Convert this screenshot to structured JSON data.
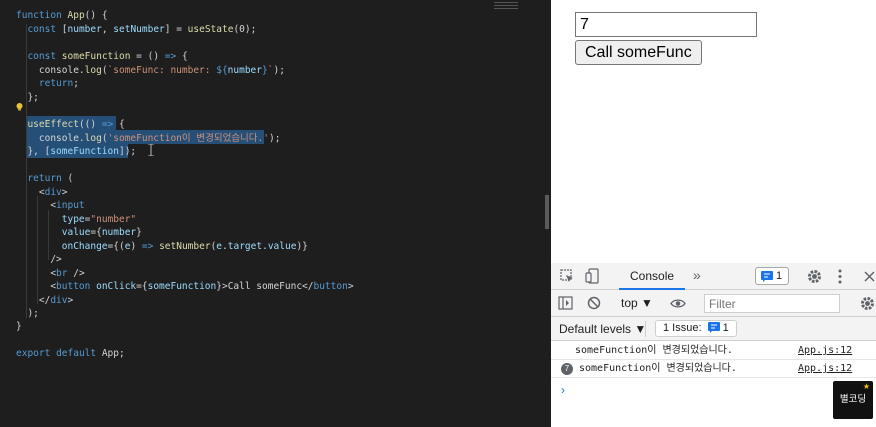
{
  "editor": {
    "lines": [
      [
        [
          "function",
          "k"
        ],
        [
          " ",
          "p"
        ],
        [
          "App",
          "f"
        ],
        [
          "() {",
          "p"
        ]
      ],
      [
        [
          "  ",
          "p"
        ],
        [
          "const",
          "k"
        ],
        [
          " [",
          "p"
        ],
        [
          "number",
          "v"
        ],
        [
          ", ",
          "p"
        ],
        [
          "setNumber",
          "v"
        ],
        [
          "] = ",
          "p"
        ],
        [
          "useState",
          "f"
        ],
        [
          "(0);",
          "p"
        ]
      ],
      [
        [
          "",
          "p"
        ]
      ],
      [
        [
          "  ",
          "p"
        ],
        [
          "const",
          "k"
        ],
        [
          " ",
          "p"
        ],
        [
          "someFunction",
          "f"
        ],
        [
          " = () ",
          "p"
        ],
        [
          "=>",
          "k"
        ],
        [
          " {",
          "p"
        ]
      ],
      [
        [
          "    console.",
          "p"
        ],
        [
          "log",
          "f"
        ],
        [
          "(",
          "p"
        ],
        [
          "`someFunc: number: ",
          "s"
        ],
        [
          "${",
          "k"
        ],
        [
          "number",
          "v"
        ],
        [
          "}",
          "k"
        ],
        [
          "`",
          "s"
        ],
        [
          ");",
          "p"
        ]
      ],
      [
        [
          "    ",
          "p"
        ],
        [
          "return",
          "k"
        ],
        [
          ";",
          "p"
        ]
      ],
      [
        [
          "  };",
          "p"
        ]
      ],
      [
        [
          "",
          "p"
        ]
      ],
      [
        [
          "  ",
          "p"
        ],
        [
          "useEffect",
          "f"
        ],
        [
          "(() ",
          "p"
        ],
        [
          "=>",
          "k"
        ],
        [
          " {",
          "p"
        ]
      ],
      [
        [
          "    console.",
          "p"
        ],
        [
          "log",
          "f"
        ],
        [
          "(",
          "p"
        ],
        [
          "'someFunction이 변경되었습니다.'",
          "s"
        ],
        [
          ");",
          "p"
        ]
      ],
      [
        [
          "  }, [",
          "p"
        ],
        [
          "someFunction",
          "v"
        ],
        [
          "]);",
          "p"
        ]
      ],
      [
        [
          "",
          "p"
        ]
      ],
      [
        [
          "  ",
          "p"
        ],
        [
          "return",
          "k"
        ],
        [
          " (",
          "p"
        ]
      ],
      [
        [
          "    <",
          "p"
        ],
        [
          "div",
          "t"
        ],
        [
          ">",
          "p"
        ]
      ],
      [
        [
          "      <",
          "p"
        ],
        [
          "input",
          "t"
        ]
      ],
      [
        [
          "        ",
          "p"
        ],
        [
          "type",
          "a"
        ],
        [
          "=",
          "p"
        ],
        [
          "\"number\"",
          "s"
        ]
      ],
      [
        [
          "        ",
          "p"
        ],
        [
          "value",
          "a"
        ],
        [
          "={",
          "p"
        ],
        [
          "number",
          "v"
        ],
        [
          "}",
          "p"
        ]
      ],
      [
        [
          "        ",
          "p"
        ],
        [
          "onChange",
          "a"
        ],
        [
          "={(",
          "p"
        ],
        [
          "e",
          "v"
        ],
        [
          ") ",
          "p"
        ],
        [
          "=>",
          "k"
        ],
        [
          " ",
          "p"
        ],
        [
          "setNumber",
          "f"
        ],
        [
          "(",
          "p"
        ],
        [
          "e",
          "v"
        ],
        [
          ".",
          "p"
        ],
        [
          "target",
          "v"
        ],
        [
          ".",
          "p"
        ],
        [
          "value",
          "v"
        ],
        [
          ")}",
          "p"
        ]
      ],
      [
        [
          "      />",
          "p"
        ]
      ],
      [
        [
          "      <",
          "p"
        ],
        [
          "br",
          "t"
        ],
        [
          " />",
          "p"
        ]
      ],
      [
        [
          "      <",
          "p"
        ],
        [
          "button",
          "t"
        ],
        [
          " ",
          "p"
        ],
        [
          "onClick",
          "a"
        ],
        [
          "={",
          "p"
        ],
        [
          "someFunction",
          "v"
        ],
        [
          "}>Call someFunc</",
          "p"
        ],
        [
          "button",
          "t"
        ],
        [
          ">",
          "p"
        ]
      ],
      [
        [
          "    </",
          "p"
        ],
        [
          "div",
          "t"
        ],
        [
          ">",
          "p"
        ]
      ],
      [
        [
          "  );",
          "p"
        ]
      ],
      [
        [
          "}",
          "p"
        ]
      ],
      [
        [
          "",
          "p"
        ]
      ],
      [
        [
          "export",
          "k"
        ],
        [
          " ",
          "p"
        ],
        [
          "default",
          "k"
        ],
        [
          " App;",
          "p"
        ]
      ]
    ]
  },
  "preview": {
    "input_value": "7",
    "button_label": "Call someFunc"
  },
  "devtools": {
    "tab_console": "Console",
    "more_tabs": "»",
    "issues_count": "1",
    "context": "top ▼",
    "filter_placeholder": "Filter",
    "levels": "Default levels ▼",
    "issue_label": "1 Issue:",
    "issue_count": "1",
    "messages": [
      {
        "text": "someFunction이 변경되었습니다.",
        "source": "App.js:12"
      },
      {
        "text": "someFunction이 변경되었습니다.",
        "source": "App.js:12",
        "repeat": "7"
      }
    ],
    "prompt": "›"
  },
  "logo": {
    "text": "별코딩",
    "star": "★"
  },
  "colors": {
    "selection": "#264f78",
    "accent": "#1a73e8"
  }
}
